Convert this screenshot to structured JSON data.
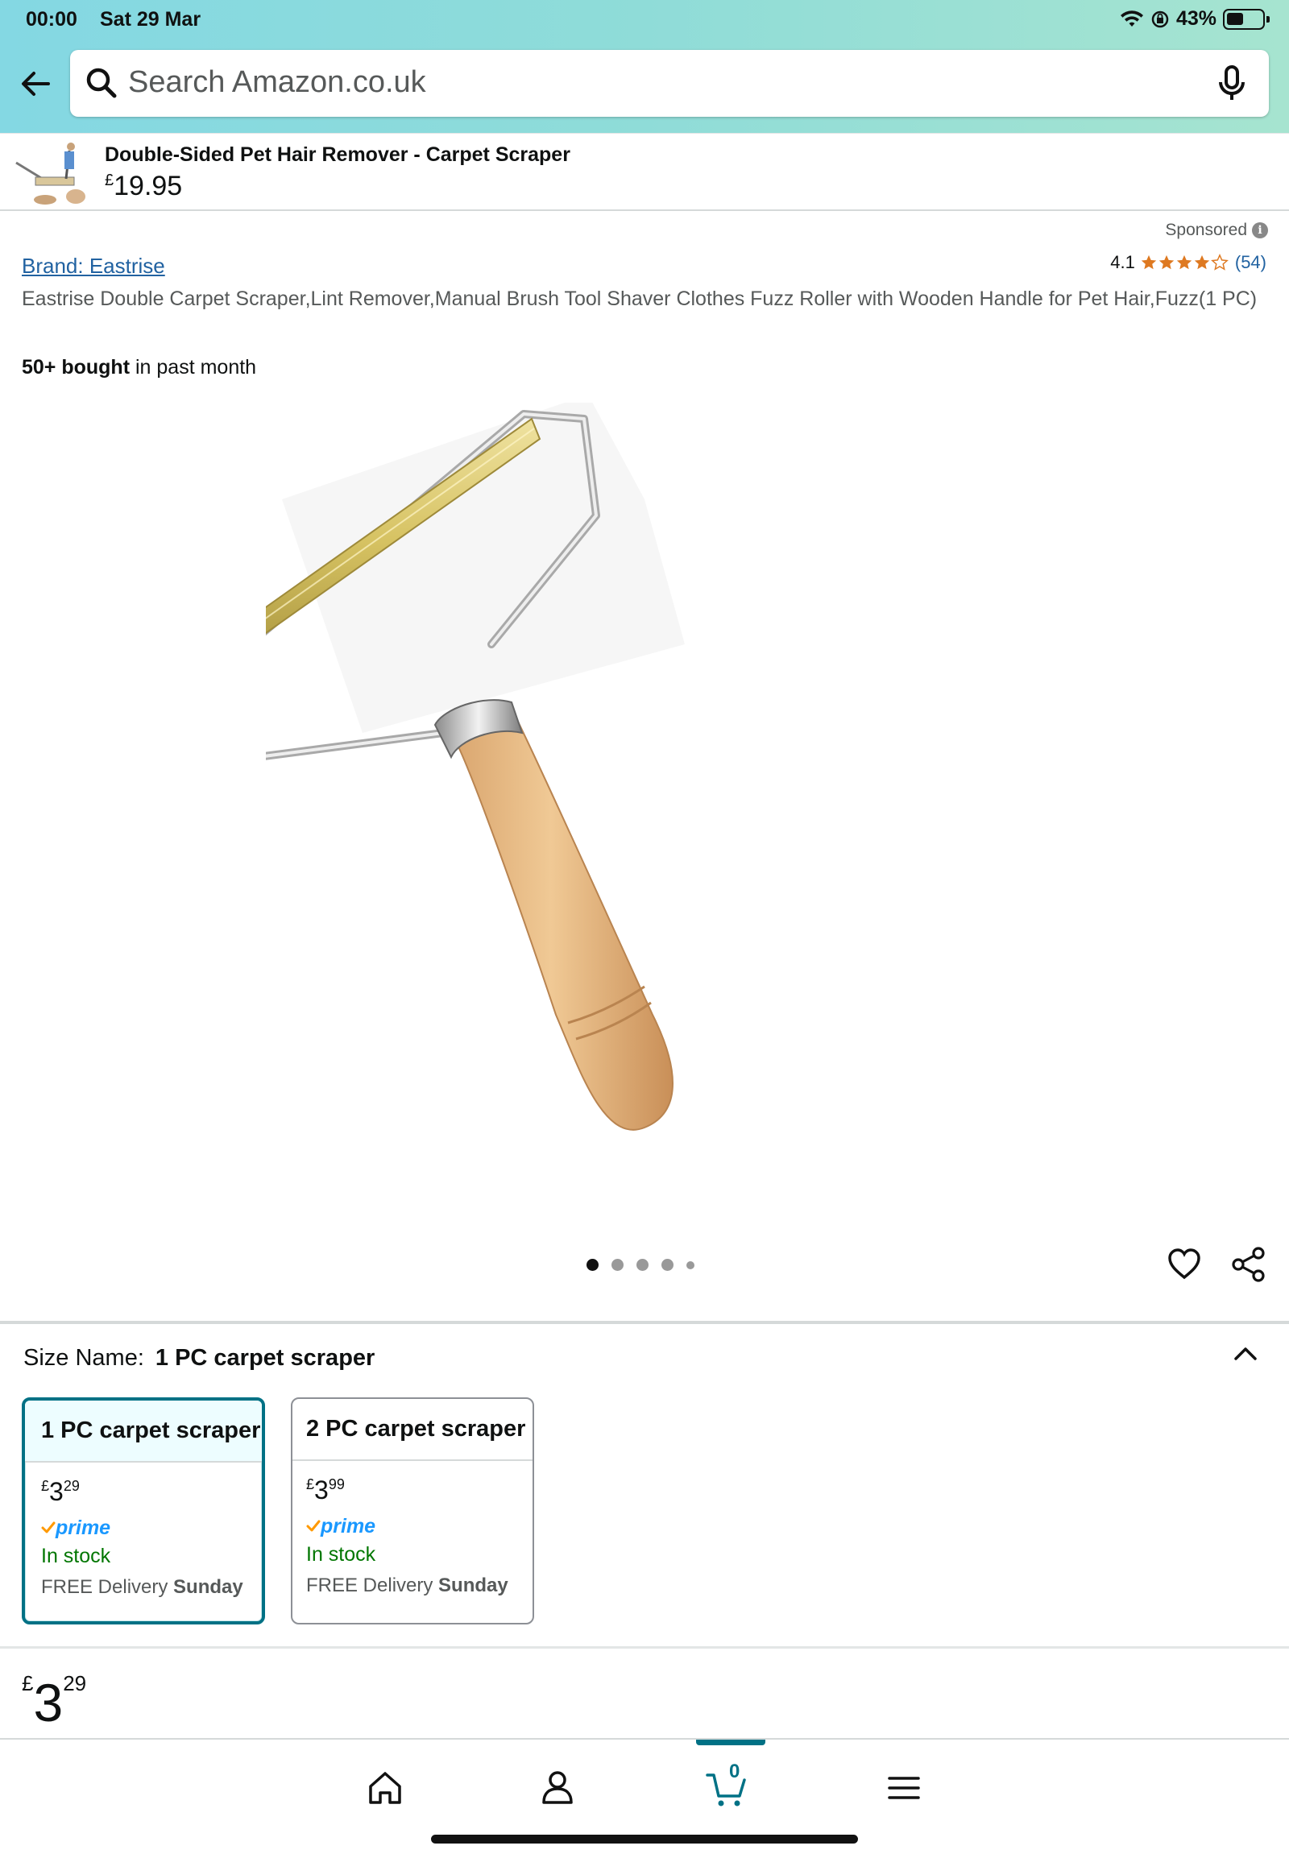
{
  "status": {
    "time": "00:00",
    "date": "Sat 29 Mar",
    "battery": "43%"
  },
  "search": {
    "placeholder": "Search Amazon.co.uk"
  },
  "sponsored_banner": {
    "title": "Double-Sided Pet Hair Remover - Carpet Scraper",
    "currency": "£",
    "price": "19.95"
  },
  "sponsored_label": "Sponsored",
  "product": {
    "brand": "Brand: Eastrise",
    "rating_value": "4.1",
    "rating_stars": 4.1,
    "rating_count": "(54)",
    "title": "Eastrise Double Carpet Scraper,Lint Remover,Manual Brush Tool Shaver Clothes Fuzz Roller with Wooden Handle for Pet Hair,Fuzz(1 PC)",
    "bought_bold": "50+ bought",
    "bought_rest": " in past month",
    "image_count": 5,
    "active_image": 1
  },
  "size": {
    "label": "Size Name:",
    "selected": "1 PC carpet scraper",
    "options": [
      {
        "name": "1 PC carpet scraper",
        "currency": "£",
        "whole": "3",
        "fraction": "29",
        "prime": "prime",
        "stock": "In stock",
        "delivery": "FREE Delivery",
        "delivery_day": "Sunday"
      },
      {
        "name": "2 PC carpet scraper",
        "currency": "£",
        "whole": "3",
        "fraction": "99",
        "prime": "prime",
        "stock": "In stock",
        "delivery": "FREE Delivery",
        "delivery_day": "Sunday"
      }
    ]
  },
  "price": {
    "currency": "£",
    "whole": "3",
    "fraction": "29"
  },
  "nav": {
    "cart_count": "0"
  },
  "colors": {
    "accent": "#007185",
    "star": "#de7921",
    "link": "#2162a1",
    "prime": "#1a98ff",
    "stock": "#007600"
  }
}
